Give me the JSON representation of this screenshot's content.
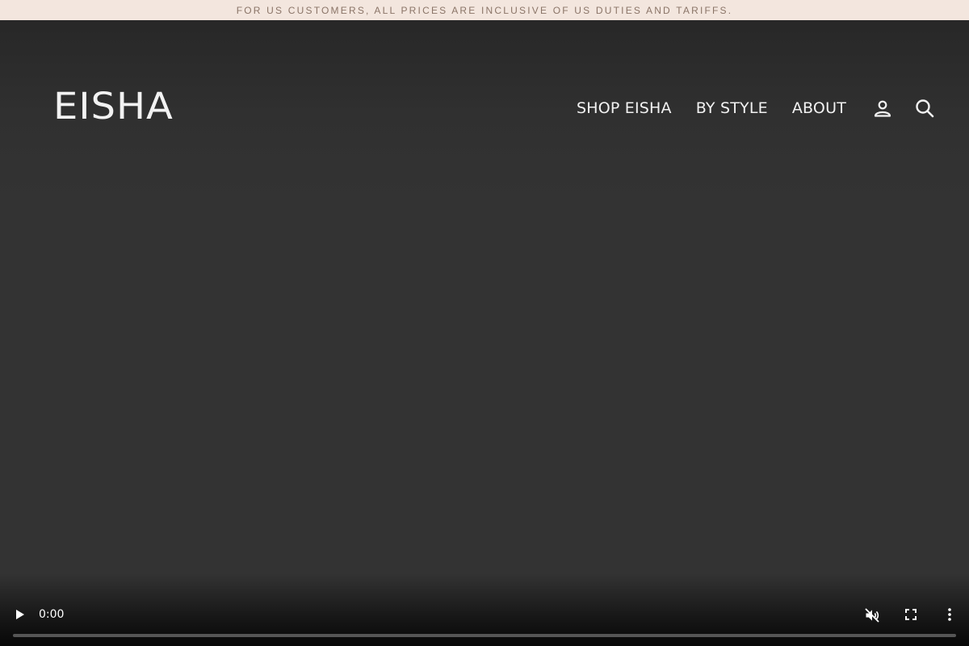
{
  "announcement": {
    "text": "FOR US CUSTOMERS, ALL PRICES ARE INCLUSIVE OF US DUTIES AND TARIFFS."
  },
  "header": {
    "logo": "EISHA",
    "nav": [
      {
        "label": "SHOP EISHA"
      },
      {
        "label": "BY STYLE"
      },
      {
        "label": "ABOUT"
      }
    ],
    "icons": [
      "account-icon",
      "search-icon"
    ]
  },
  "video": {
    "current_time": "0:00",
    "progress": 0,
    "muted": true,
    "icons": [
      "play-icon",
      "mute-icon",
      "fullscreen-icon",
      "more-options-icon"
    ]
  },
  "colors": {
    "announcement_bg": "#f3e6de",
    "announcement_text": "#8a7467",
    "hero_bg": "#333333",
    "header_text": "#f2f2f2"
  }
}
